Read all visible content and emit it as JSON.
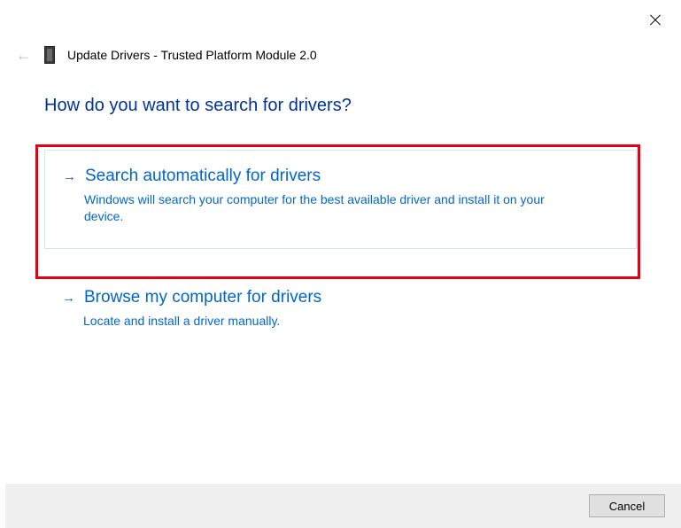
{
  "header": {
    "title": "Update Drivers - Trusted Platform Module 2.0"
  },
  "main": {
    "question": "How do you want to search for drivers?",
    "options": [
      {
        "title": "Search automatically for drivers",
        "description": "Windows will search your computer for the best available driver and install it on your device."
      },
      {
        "title": "Browse my computer for drivers",
        "description": "Locate and install a driver manually."
      }
    ]
  },
  "footer": {
    "cancel_label": "Cancel"
  }
}
